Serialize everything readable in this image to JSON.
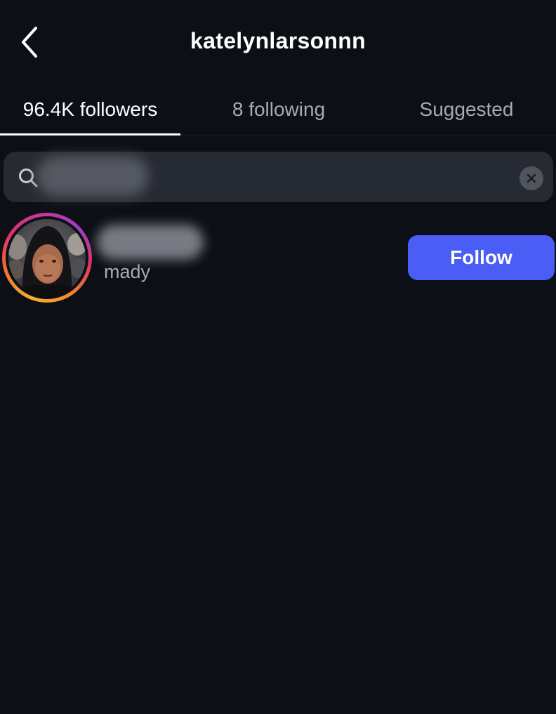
{
  "header": {
    "title": "katelynlarsonnn",
    "back_icon": "chevron-left-icon"
  },
  "tabs": [
    {
      "label": "96.4K followers",
      "active": true
    },
    {
      "label": "8 following",
      "active": false
    },
    {
      "label": "Suggested",
      "active": false
    }
  ],
  "search": {
    "value": "",
    "value_obscured": true,
    "icon": "search-icon",
    "clear_icon": "clear-icon"
  },
  "results": [
    {
      "username_obscured": true,
      "display_name": "mady",
      "has_story_ring": true,
      "follow_label": "Follow"
    }
  ],
  "colors": {
    "background": "#0c0f16",
    "search_background": "#262a33",
    "follow_button": "#4a5df5",
    "muted_text": "#a7abb3"
  }
}
